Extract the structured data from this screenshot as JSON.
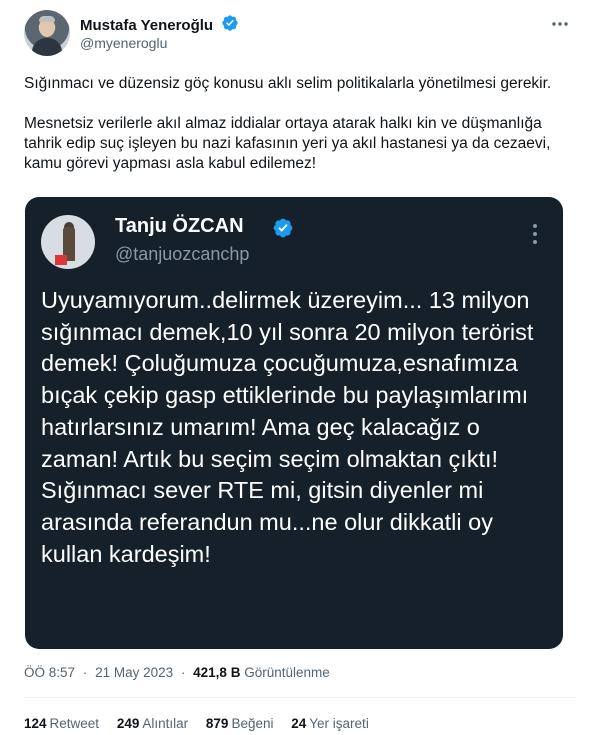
{
  "author": {
    "name": "Mustafa Yeneroğlu",
    "handle": "@myeneroglu"
  },
  "tweet": {
    "paragraph1": "Sığınmacı ve düzensiz göç konusu aklı selim politikalarla yönetilmesi gerekir.",
    "paragraph2": "Mesnetsiz verilerle akıl almaz iddialar ortaya atarak halkı kin ve düşmanlığa tahrik edip suç işleyen bu nazi kafasının yeri ya akıl hastanesi ya da cezaevi, kamu görevi yapması asla kabul edilemez!"
  },
  "quoted": {
    "name": "Tanju ÖZCAN",
    "handle": "@tanjuozcanchp",
    "text": "Uyuyamıyorum..delirmek üzereyim... 13 milyon sığınmacı demek,10 yıl sonra 20 milyon terörist demek! Çoluğumuza çocuğumuza,esnafımıza bıçak çekip gasp ettiklerinde bu  paylaşımlarımı hatırlarsınız umarım! Ama geç kalacağız o zaman! Artık bu seçim seçim olmaktan çıktı! Sığınmacı sever RTE mi, gitsin diyenler mi arasında referandun mu...ne olur dikkatli oy kullan kardeşim!"
  },
  "meta": {
    "time": "ÖÖ 8:57",
    "date": "21 May 2023",
    "separator": "·",
    "views_count": "421,8 B",
    "views_label": "Görüntülenme"
  },
  "stats": {
    "retweets_count": "124",
    "retweets_label": "Retweet",
    "quotes_count": "249",
    "quotes_label": "Alıntılar",
    "likes_count": "879",
    "likes_label": "Beğeni",
    "bookmarks_count": "24",
    "bookmarks_label": "Yer işareti"
  },
  "colors": {
    "verified": "#1d9bf0",
    "card_background": "#15202b",
    "secondary_text": "#536471"
  },
  "icons": {
    "verified": "verified-badge-icon",
    "more": "more-options-icon"
  }
}
